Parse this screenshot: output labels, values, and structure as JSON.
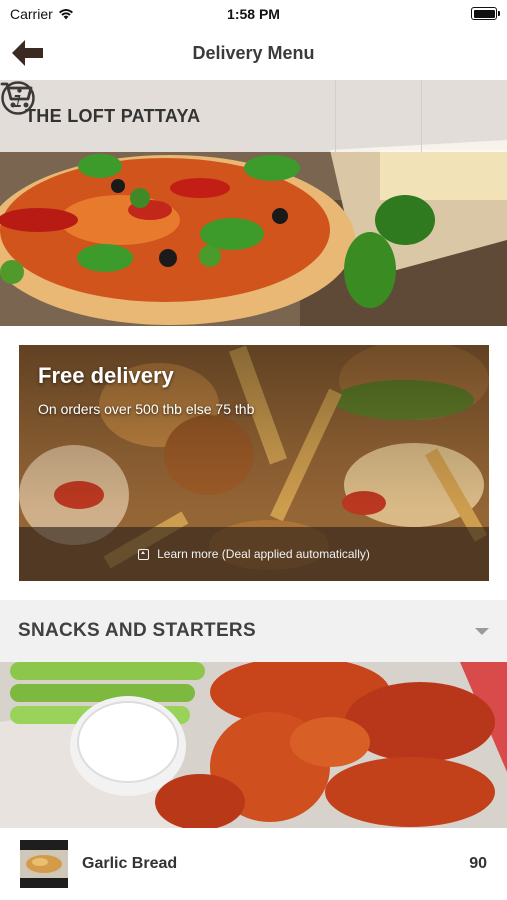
{
  "status_bar": {
    "carrier": "Carrier",
    "time": "1:58 PM"
  },
  "nav": {
    "title": "Delivery Menu",
    "back_icon": "arrow-left-icon"
  },
  "restaurant": {
    "name": "THE LOFT PATTAYA",
    "info_icon": "info-icon",
    "cart_icon": "cart-icon"
  },
  "promo": {
    "title": "Free delivery",
    "subtitle": "On orders over 500 thb else 75 thb",
    "learn_more": "Learn more (Deal applied automatically)"
  },
  "category": {
    "title": "SNACKS AND STARTERS",
    "expanded": true
  },
  "items": [
    {
      "name": "Garlic Bread",
      "price": "90"
    }
  ],
  "colors": {
    "nav_back": "#3a2a22",
    "category_bg": "#f1f1f1",
    "text_dark": "#333333"
  }
}
